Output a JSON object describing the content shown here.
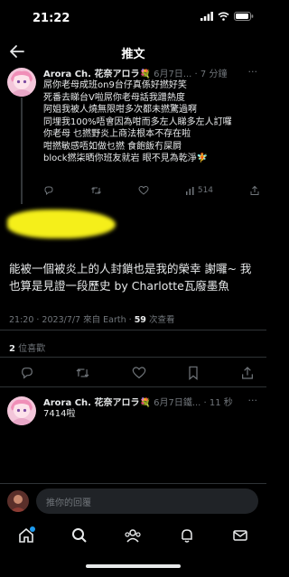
{
  "status": {
    "time": "21:22"
  },
  "nav": {
    "title": "推文"
  },
  "reply_tweet": {
    "name": "Arora Ch. 花奈アロラ💐",
    "handle": "6月7日...",
    "time": "7 分鐘",
    "lines": [
      "屌你老母成班on9台仔真係好撚好笑",
      "死番去睇台V啦屌你老母話我蹭熱度",
      "阿姐我被人燒無限咁多次都未撚驚過啊",
      "同埋我100%唔會因為咁而多左人睇多左人訂囉",
      "你老母 乜撚野炎上商法根本不存在啦",
      "咁撚敏感唔如做乜撚 食飽飯冇屎屙",
      "block撚柒晒你班友就岩 眼不見為乾淨🧚"
    ],
    "views": "514"
  },
  "main_tweet": {
    "text": "能被一個被炎上的人封鎖也是我的榮幸 謝囉~ 我也算是見證一段歷史 by Charlotte瓦廢墨魚",
    "timestamp": "21:20 · 2023/7/7 來自 Earth · ",
    "views_count": "59",
    "views_label": " 次查看",
    "likes_count": "2",
    "likes_label": " 位喜歡"
  },
  "bottom_tweet": {
    "name": "Arora Ch. 花奈アロラ💐",
    "handle": "6月7日鐵...",
    "time": "11 秒",
    "text": "7414啦"
  },
  "reply_placeholder": "推你的回覆",
  "colors": {
    "background": "#000000",
    "muted": "#71767b",
    "accent": "#1d9bf0",
    "highlight": "#f5ef1a"
  }
}
